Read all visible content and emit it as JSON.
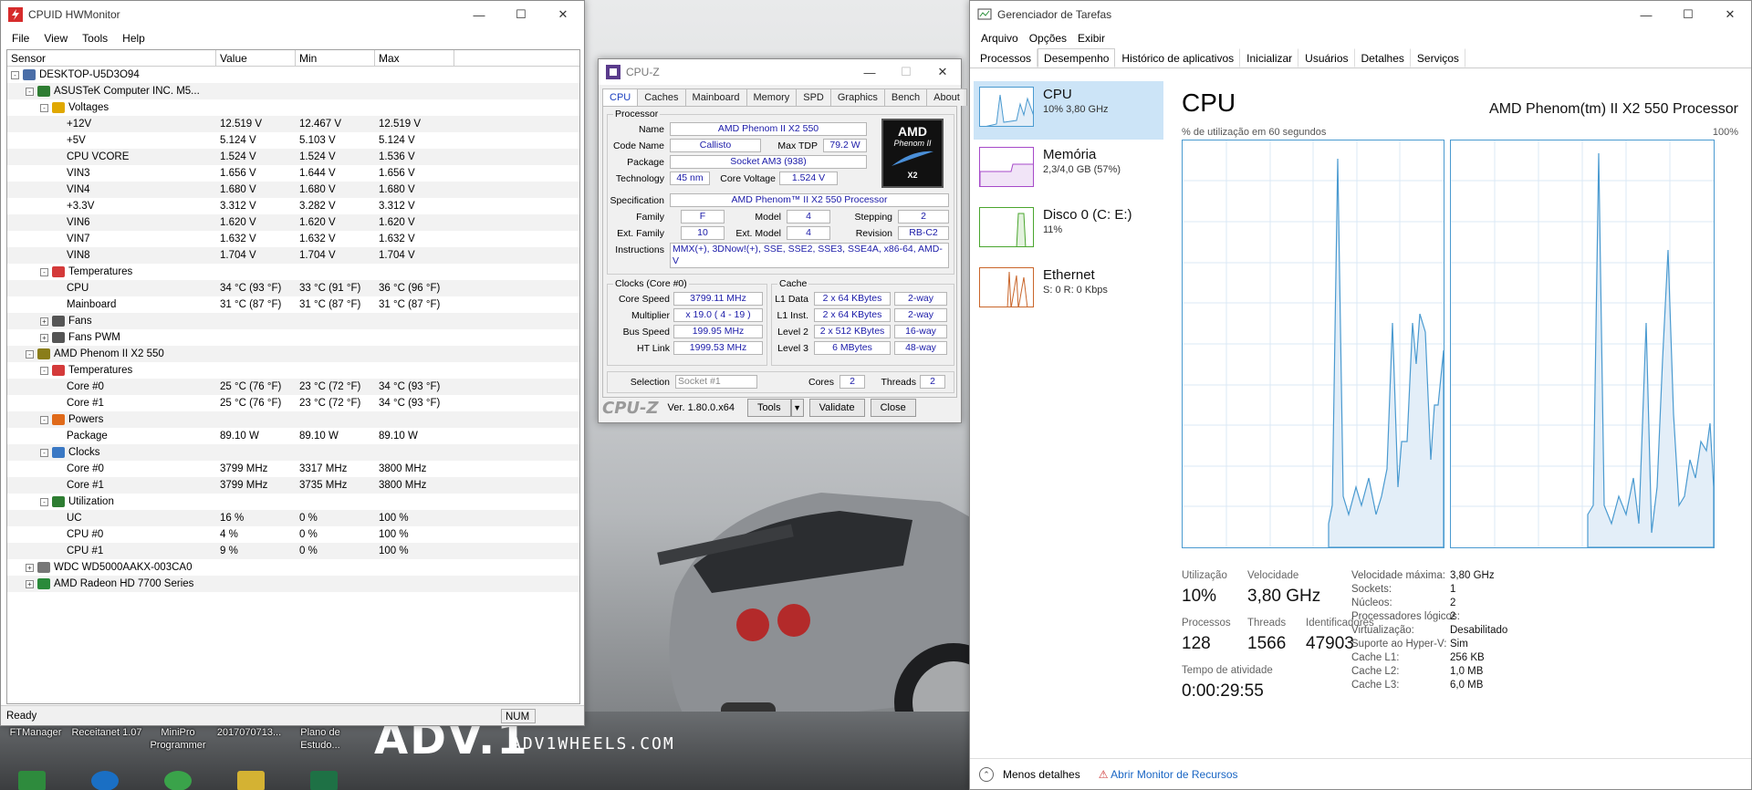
{
  "desktop": {
    "brand": "ADV.1",
    "brand_site": "ADV1WHEELS.COM",
    "icons": [
      {
        "label": "FTManager"
      },
      {
        "label": "Receitanet 1.07"
      },
      {
        "label": "MiniPro Programmer"
      },
      {
        "label": "2017070713..."
      },
      {
        "label": "Plano de Estudo..."
      }
    ]
  },
  "hwmonitor": {
    "title": "CPUID HWMonitor",
    "menu": [
      "File",
      "View",
      "Tools",
      "Help"
    ],
    "columns": {
      "sensor": "Sensor",
      "value": "Value",
      "min": "Min",
      "max": "Max"
    },
    "rows": [
      {
        "level": 0,
        "exp": "-",
        "icon": "computer",
        "name": "DESKTOP-U5D3O94",
        "value": "",
        "min": "",
        "max": ""
      },
      {
        "level": 1,
        "exp": "-",
        "icon": "board",
        "name": "ASUSTeK Computer INC. M5...",
        "value": "",
        "min": "",
        "max": ""
      },
      {
        "level": 2,
        "exp": "-",
        "icon": "volt",
        "name": "Voltages",
        "value": "",
        "min": "",
        "max": ""
      },
      {
        "level": 3,
        "exp": "",
        "icon": "",
        "name": "+12V",
        "value": "12.519 V",
        "min": "12.467 V",
        "max": "12.519 V"
      },
      {
        "level": 3,
        "exp": "",
        "icon": "",
        "name": "+5V",
        "value": "5.124 V",
        "min": "5.103 V",
        "max": "5.124 V"
      },
      {
        "level": 3,
        "exp": "",
        "icon": "",
        "name": "CPU VCORE",
        "value": "1.524 V",
        "min": "1.524 V",
        "max": "1.536 V"
      },
      {
        "level": 3,
        "exp": "",
        "icon": "",
        "name": "VIN3",
        "value": "1.656 V",
        "min": "1.644 V",
        "max": "1.656 V"
      },
      {
        "level": 3,
        "exp": "",
        "icon": "",
        "name": "VIN4",
        "value": "1.680 V",
        "min": "1.680 V",
        "max": "1.680 V"
      },
      {
        "level": 3,
        "exp": "",
        "icon": "",
        "name": "+3.3V",
        "value": "3.312 V",
        "min": "3.282 V",
        "max": "3.312 V"
      },
      {
        "level": 3,
        "exp": "",
        "icon": "",
        "name": "VIN6",
        "value": "1.620 V",
        "min": "1.620 V",
        "max": "1.620 V"
      },
      {
        "level": 3,
        "exp": "",
        "icon": "",
        "name": "VIN7",
        "value": "1.632 V",
        "min": "1.632 V",
        "max": "1.632 V"
      },
      {
        "level": 3,
        "exp": "",
        "icon": "",
        "name": "VIN8",
        "value": "1.704 V",
        "min": "1.704 V",
        "max": "1.704 V"
      },
      {
        "level": 2,
        "exp": "-",
        "icon": "temp",
        "name": "Temperatures",
        "value": "",
        "min": "",
        "max": ""
      },
      {
        "level": 3,
        "exp": "",
        "icon": "",
        "name": "CPU",
        "value": "34 °C  (93 °F)",
        "min": "33 °C  (91 °F)",
        "max": "36 °C  (96 °F)"
      },
      {
        "level": 3,
        "exp": "",
        "icon": "",
        "name": "Mainboard",
        "value": "31 °C  (87 °F)",
        "min": "31 °C  (87 °F)",
        "max": "31 °C  (87 °F)"
      },
      {
        "level": 2,
        "exp": "+",
        "icon": "fan",
        "name": "Fans",
        "value": "",
        "min": "",
        "max": ""
      },
      {
        "level": 2,
        "exp": "+",
        "icon": "fan",
        "name": "Fans PWM",
        "value": "",
        "min": "",
        "max": ""
      },
      {
        "level": 1,
        "exp": "-",
        "icon": "chip",
        "name": "AMD Phenom II X2 550",
        "value": "",
        "min": "",
        "max": ""
      },
      {
        "level": 2,
        "exp": "-",
        "icon": "temp",
        "name": "Temperatures",
        "value": "",
        "min": "",
        "max": ""
      },
      {
        "level": 3,
        "exp": "",
        "icon": "",
        "name": "Core #0",
        "value": "25 °C  (76 °F)",
        "min": "23 °C  (72 °F)",
        "max": "34 °C  (93 °F)"
      },
      {
        "level": 3,
        "exp": "",
        "icon": "",
        "name": "Core #1",
        "value": "25 °C  (76 °F)",
        "min": "23 °C  (72 °F)",
        "max": "34 °C  (93 °F)"
      },
      {
        "level": 2,
        "exp": "-",
        "icon": "power",
        "name": "Powers",
        "value": "",
        "min": "",
        "max": ""
      },
      {
        "level": 3,
        "exp": "",
        "icon": "",
        "name": "Package",
        "value": "89.10 W",
        "min": "89.10 W",
        "max": "89.10 W"
      },
      {
        "level": 2,
        "exp": "-",
        "icon": "clock",
        "name": "Clocks",
        "value": "",
        "min": "",
        "max": ""
      },
      {
        "level": 3,
        "exp": "",
        "icon": "",
        "name": "Core #0",
        "value": "3799 MHz",
        "min": "3317 MHz",
        "max": "3800 MHz"
      },
      {
        "level": 3,
        "exp": "",
        "icon": "",
        "name": "Core #1",
        "value": "3799 MHz",
        "min": "3735 MHz",
        "max": "3800 MHz"
      },
      {
        "level": 2,
        "exp": "-",
        "icon": "util",
        "name": "Utilization",
        "value": "",
        "min": "",
        "max": ""
      },
      {
        "level": 3,
        "exp": "",
        "icon": "",
        "name": "UC",
        "value": "16 %",
        "min": "0 %",
        "max": "100 %"
      },
      {
        "level": 3,
        "exp": "",
        "icon": "",
        "name": "CPU #0",
        "value": "4 %",
        "min": "0 %",
        "max": "100 %"
      },
      {
        "level": 3,
        "exp": "",
        "icon": "",
        "name": "CPU #1",
        "value": "9 %",
        "min": "0 %",
        "max": "100 %"
      },
      {
        "level": 1,
        "exp": "+",
        "icon": "disk",
        "name": "WDC WD5000AAKX-003CA0",
        "value": "",
        "min": "",
        "max": ""
      },
      {
        "level": 1,
        "exp": "+",
        "icon": "gpu",
        "name": "AMD Radeon HD 7700 Series",
        "value": "",
        "min": "",
        "max": ""
      }
    ],
    "status": "Ready",
    "num": "NUM"
  },
  "cpuz": {
    "title": "CPU-Z",
    "tabs": [
      "CPU",
      "Caches",
      "Mainboard",
      "Memory",
      "SPD",
      "Graphics",
      "Bench",
      "About"
    ],
    "processor_group": "Processor",
    "name_lbl": "Name",
    "name": "AMD Phenom II X2 550",
    "codename_lbl": "Code Name",
    "codename": "Callisto",
    "maxtdp_lbl": "Max TDP",
    "maxtdp": "79.2 W",
    "package_lbl": "Package",
    "package": "Socket AM3 (938)",
    "tech_lbl": "Technology",
    "tech": "45 nm",
    "corev_lbl": "Core Voltage",
    "corev": "1.524 V",
    "spec_lbl": "Specification",
    "spec": "AMD Phenom™ II X2 550 Processor",
    "family_lbl": "Family",
    "family": "F",
    "model_lbl": "Model",
    "model": "4",
    "stepping_lbl": "Stepping",
    "stepping": "2",
    "extfam_lbl": "Ext. Family",
    "extfam": "10",
    "extmodel_lbl": "Ext. Model",
    "extmodel": "4",
    "revision_lbl": "Revision",
    "revision": "RB-C2",
    "instr_lbl": "Instructions",
    "instr": "MMX(+), 3DNow!(+), SSE, SSE2, SSE3, SSE4A, x86-64, AMD-V",
    "clocks_group": "Clocks (Core #0)",
    "corespeed_lbl": "Core Speed",
    "corespeed": "3799.11 MHz",
    "mult_lbl": "Multiplier",
    "mult": "x 19.0 ( 4 - 19 )",
    "bus_lbl": "Bus Speed",
    "bus": "199.95 MHz",
    "ht_lbl": "HT Link",
    "ht": "1999.53 MHz",
    "cache_group": "Cache",
    "l1d_lbl": "L1 Data",
    "l1d": "2 x 64 KBytes",
    "l1d_way": "2-way",
    "l1i_lbl": "L1 Inst.",
    "l1i": "2 x 64 KBytes",
    "l1i_way": "2-way",
    "l2_lbl": "Level 2",
    "l2": "2 x 512 KBytes",
    "l2_way": "16-way",
    "l3_lbl": "Level 3",
    "l3": "6 MBytes",
    "l3_way": "48-way",
    "selection_lbl": "Selection",
    "selection": "Socket #1",
    "cores_lbl": "Cores",
    "cores": "2",
    "threads_lbl": "Threads",
    "threads": "2",
    "logo": "CPU-Z",
    "version": "Ver. 1.80.0.x64",
    "tools_btn": "Tools",
    "validate_btn": "Validate",
    "close_btn": "Close",
    "badge_brand": "AMD",
    "badge_line": "Phenom II",
    "badge_model": "X2"
  },
  "taskmgr": {
    "title": "Gerenciador de Tarefas",
    "menu": [
      "Arquivo",
      "Opções",
      "Exibir"
    ],
    "tabs": [
      "Processos",
      "Desempenho",
      "Histórico de aplicativos",
      "Inicializar",
      "Usuários",
      "Detalhes",
      "Serviços"
    ],
    "resources": [
      {
        "name": "CPU",
        "sub": "10%  3,80 GHz",
        "color": "#4a9ad0"
      },
      {
        "name": "Memória",
        "sub": "2,3/4,0 GB (57%)",
        "color": "#a64ac9"
      },
      {
        "name": "Disco 0 (C: E:)",
        "sub": "11%",
        "color": "#4aa52e"
      },
      {
        "name": "Ethernet",
        "sub": "S: 0 R: 0 Kbps",
        "color": "#c9652a"
      }
    ],
    "heading": "CPU",
    "processor": "AMD Phenom(tm) II X2 550 Processor",
    "util_label": "% de utilização em 60 segundos",
    "max_label": "100%",
    "stats": {
      "util_lbl": "Utilização",
      "util": "10%",
      "speed_lbl": "Velocidade",
      "speed": "3,80 GHz",
      "proc_lbl": "Processos",
      "proc": "128",
      "threads_lbl": "Threads",
      "threads": "1566",
      "handles_lbl": "Identificadores",
      "handles": "47903",
      "uptime_lbl": "Tempo de atividade",
      "uptime": "0:00:29:55"
    },
    "details": [
      {
        "k": "Velocidade máxima:",
        "v": "3,80 GHz"
      },
      {
        "k": "Sockets:",
        "v": "1"
      },
      {
        "k": "Núcleos:",
        "v": "2"
      },
      {
        "k": "Processadores lógicos:",
        "v": "2"
      },
      {
        "k": "Virtualização:",
        "v": "Desabilitado"
      },
      {
        "k": "Suporte ao Hyper-V:",
        "v": "Sim"
      },
      {
        "k": "Cache L1:",
        "v": "256 KB"
      },
      {
        "k": "Cache L2:",
        "v": "1,0 MB"
      },
      {
        "k": "Cache L3:",
        "v": "6,0 MB"
      }
    ],
    "less_details": "Menos detalhes",
    "resource_monitor": "Abrir Monitor de Recursos"
  }
}
